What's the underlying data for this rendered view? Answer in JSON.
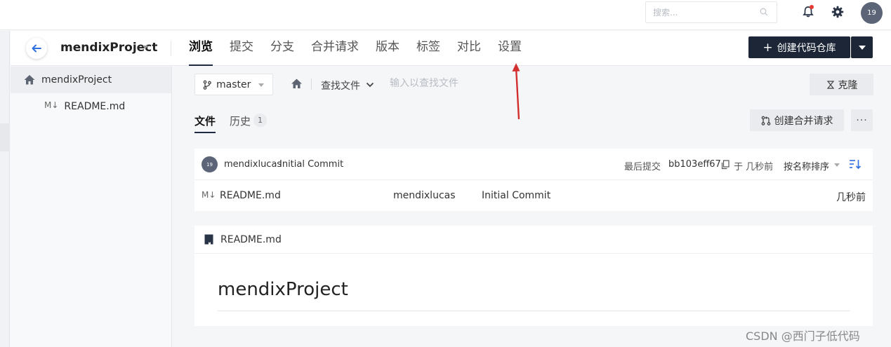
{
  "topbar": {
    "search_placeholder": "搜索...",
    "avatar_text": "19",
    "icons": [
      "search-icon",
      "bell-icon",
      "gear-icon"
    ],
    "notification_dot_color": "#e53935"
  },
  "project": {
    "name": "mendixProject",
    "tabs": [
      {
        "label": "浏览",
        "active": true
      },
      {
        "label": "提交"
      },
      {
        "label": "分支"
      },
      {
        "label": "合并请求"
      },
      {
        "label": "版本"
      },
      {
        "label": "标签"
      },
      {
        "label": "对比"
      },
      {
        "label": "设置"
      }
    ],
    "create_repo_label": "创建代码仓库",
    "create_repo_plus": "+"
  },
  "sidebar": {
    "items": [
      {
        "label": "mendixProject",
        "icon": "home-icon"
      },
      {
        "label": "README.md",
        "icon": "markdown-icon",
        "icon_text": "M↓"
      }
    ]
  },
  "toolbar": {
    "branch": "master",
    "find_file_label": "查找文件",
    "find_file_placeholder": "输入以查找文件",
    "clone_label": "克隆"
  },
  "subtabs": {
    "files": "文件",
    "history": "历史",
    "history_count": "1",
    "merge_request_label": "创建合并请求",
    "more_label": "···"
  },
  "commit": {
    "avatar_text": "19",
    "author": "mendixlucas",
    "message": "Initial Commit",
    "last_commit_label": "最后提交",
    "hash": "bb103eff67",
    "time": "于 几秒前",
    "sort_label": "按名称排序"
  },
  "files": [
    {
      "icon_text": "M↓",
      "name": "README.md",
      "author": "mendixlucas",
      "message": "Initial Commit",
      "time": "几秒前"
    }
  ],
  "readme": {
    "title": "README.md",
    "heading": "mendixProject"
  },
  "watermark": "CSDN @西门子低代码",
  "colors": {
    "primary_dark": "#1c2636",
    "annotation": "#d32f2f",
    "accent_blue": "#2f6fde"
  }
}
